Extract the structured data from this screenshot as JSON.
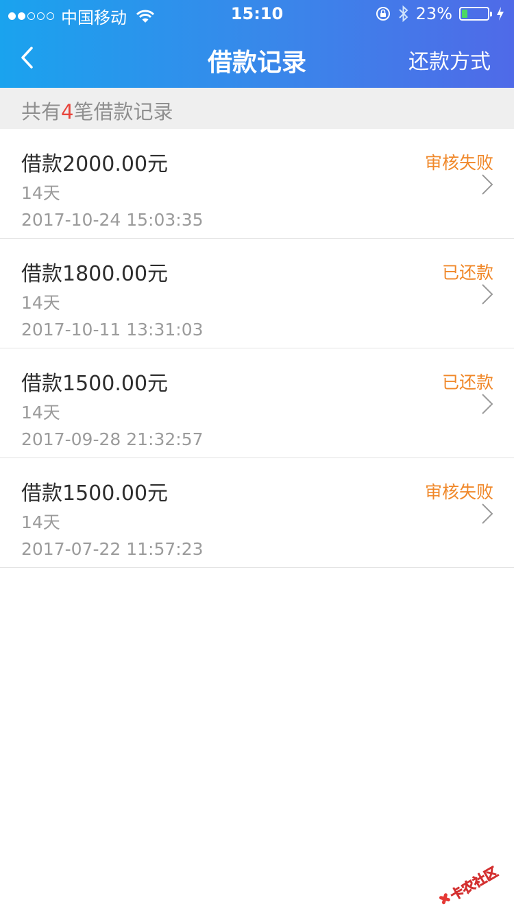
{
  "status_bar": {
    "carrier": "中国移动",
    "time": "15:10",
    "battery": "23%",
    "battery_level": 0.23,
    "icons": [
      "signal-dots-icon",
      "wifi-icon",
      "rotation-lock-icon",
      "bluetooth-icon",
      "battery-icon",
      "charging-icon"
    ]
  },
  "navbar": {
    "back_icon": "chevron-left-icon",
    "title": "借款记录",
    "right_action": "还款方式"
  },
  "summary": {
    "prefix": "共有",
    "count": "4",
    "suffix": "笔借款记录"
  },
  "records": [
    {
      "amount": "借款2000.00元",
      "duration": "14天",
      "date": "2017-10-24 15:03:35",
      "status": "审核失败"
    },
    {
      "amount": "借款1800.00元",
      "duration": "14天",
      "date": "2017-10-11 13:31:03",
      "status": "已还款"
    },
    {
      "amount": "借款1500.00元",
      "duration": "14天",
      "date": "2017-09-28 21:32:57",
      "status": "已还款"
    },
    {
      "amount": "借款1500.00元",
      "duration": "14天",
      "date": "2017-07-22 11:57:23",
      "status": "审核失败"
    }
  ],
  "watermark": {
    "text": "卡农社区"
  },
  "colors": {
    "header_gradient_start": "#1aa3ee",
    "header_gradient_end": "#4f6ae8",
    "status_orange": "#f0882a",
    "count_red": "#e8453c",
    "summary_bg": "#efefef"
  }
}
